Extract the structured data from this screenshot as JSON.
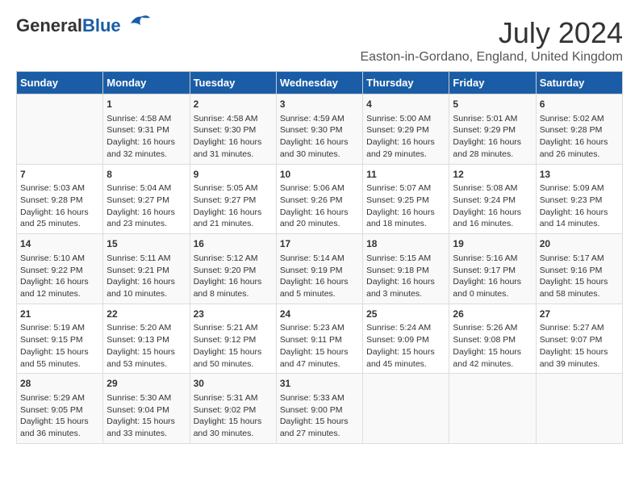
{
  "header": {
    "logo_line1": "General",
    "logo_line2": "Blue",
    "main_title": "July 2024",
    "subtitle": "Easton-in-Gordano, England, United Kingdom"
  },
  "calendar": {
    "days_of_week": [
      "Sunday",
      "Monday",
      "Tuesday",
      "Wednesday",
      "Thursday",
      "Friday",
      "Saturday"
    ],
    "weeks": [
      [
        {
          "day": "",
          "content": ""
        },
        {
          "day": "1",
          "content": "Sunrise: 4:58 AM\nSunset: 9:31 PM\nDaylight: 16 hours\nand 32 minutes."
        },
        {
          "day": "2",
          "content": "Sunrise: 4:58 AM\nSunset: 9:30 PM\nDaylight: 16 hours\nand 31 minutes."
        },
        {
          "day": "3",
          "content": "Sunrise: 4:59 AM\nSunset: 9:30 PM\nDaylight: 16 hours\nand 30 minutes."
        },
        {
          "day": "4",
          "content": "Sunrise: 5:00 AM\nSunset: 9:29 PM\nDaylight: 16 hours\nand 29 minutes."
        },
        {
          "day": "5",
          "content": "Sunrise: 5:01 AM\nSunset: 9:29 PM\nDaylight: 16 hours\nand 28 minutes."
        },
        {
          "day": "6",
          "content": "Sunrise: 5:02 AM\nSunset: 9:28 PM\nDaylight: 16 hours\nand 26 minutes."
        }
      ],
      [
        {
          "day": "7",
          "content": "Sunrise: 5:03 AM\nSunset: 9:28 PM\nDaylight: 16 hours\nand 25 minutes."
        },
        {
          "day": "8",
          "content": "Sunrise: 5:04 AM\nSunset: 9:27 PM\nDaylight: 16 hours\nand 23 minutes."
        },
        {
          "day": "9",
          "content": "Sunrise: 5:05 AM\nSunset: 9:27 PM\nDaylight: 16 hours\nand 21 minutes."
        },
        {
          "day": "10",
          "content": "Sunrise: 5:06 AM\nSunset: 9:26 PM\nDaylight: 16 hours\nand 20 minutes."
        },
        {
          "day": "11",
          "content": "Sunrise: 5:07 AM\nSunset: 9:25 PM\nDaylight: 16 hours\nand 18 minutes."
        },
        {
          "day": "12",
          "content": "Sunrise: 5:08 AM\nSunset: 9:24 PM\nDaylight: 16 hours\nand 16 minutes."
        },
        {
          "day": "13",
          "content": "Sunrise: 5:09 AM\nSunset: 9:23 PM\nDaylight: 16 hours\nand 14 minutes."
        }
      ],
      [
        {
          "day": "14",
          "content": "Sunrise: 5:10 AM\nSunset: 9:22 PM\nDaylight: 16 hours\nand 12 minutes."
        },
        {
          "day": "15",
          "content": "Sunrise: 5:11 AM\nSunset: 9:21 PM\nDaylight: 16 hours\nand 10 minutes."
        },
        {
          "day": "16",
          "content": "Sunrise: 5:12 AM\nSunset: 9:20 PM\nDaylight: 16 hours\nand 8 minutes."
        },
        {
          "day": "17",
          "content": "Sunrise: 5:14 AM\nSunset: 9:19 PM\nDaylight: 16 hours\nand 5 minutes."
        },
        {
          "day": "18",
          "content": "Sunrise: 5:15 AM\nSunset: 9:18 PM\nDaylight: 16 hours\nand 3 minutes."
        },
        {
          "day": "19",
          "content": "Sunrise: 5:16 AM\nSunset: 9:17 PM\nDaylight: 16 hours\nand 0 minutes."
        },
        {
          "day": "20",
          "content": "Sunrise: 5:17 AM\nSunset: 9:16 PM\nDaylight: 15 hours\nand 58 minutes."
        }
      ],
      [
        {
          "day": "21",
          "content": "Sunrise: 5:19 AM\nSunset: 9:15 PM\nDaylight: 15 hours\nand 55 minutes."
        },
        {
          "day": "22",
          "content": "Sunrise: 5:20 AM\nSunset: 9:13 PM\nDaylight: 15 hours\nand 53 minutes."
        },
        {
          "day": "23",
          "content": "Sunrise: 5:21 AM\nSunset: 9:12 PM\nDaylight: 15 hours\nand 50 minutes."
        },
        {
          "day": "24",
          "content": "Sunrise: 5:23 AM\nSunset: 9:11 PM\nDaylight: 15 hours\nand 47 minutes."
        },
        {
          "day": "25",
          "content": "Sunrise: 5:24 AM\nSunset: 9:09 PM\nDaylight: 15 hours\nand 45 minutes."
        },
        {
          "day": "26",
          "content": "Sunrise: 5:26 AM\nSunset: 9:08 PM\nDaylight: 15 hours\nand 42 minutes."
        },
        {
          "day": "27",
          "content": "Sunrise: 5:27 AM\nSunset: 9:07 PM\nDaylight: 15 hours\nand 39 minutes."
        }
      ],
      [
        {
          "day": "28",
          "content": "Sunrise: 5:29 AM\nSunset: 9:05 PM\nDaylight: 15 hours\nand 36 minutes."
        },
        {
          "day": "29",
          "content": "Sunrise: 5:30 AM\nSunset: 9:04 PM\nDaylight: 15 hours\nand 33 minutes."
        },
        {
          "day": "30",
          "content": "Sunrise: 5:31 AM\nSunset: 9:02 PM\nDaylight: 15 hours\nand 30 minutes."
        },
        {
          "day": "31",
          "content": "Sunrise: 5:33 AM\nSunset: 9:00 PM\nDaylight: 15 hours\nand 27 minutes."
        },
        {
          "day": "",
          "content": ""
        },
        {
          "day": "",
          "content": ""
        },
        {
          "day": "",
          "content": ""
        }
      ]
    ]
  }
}
